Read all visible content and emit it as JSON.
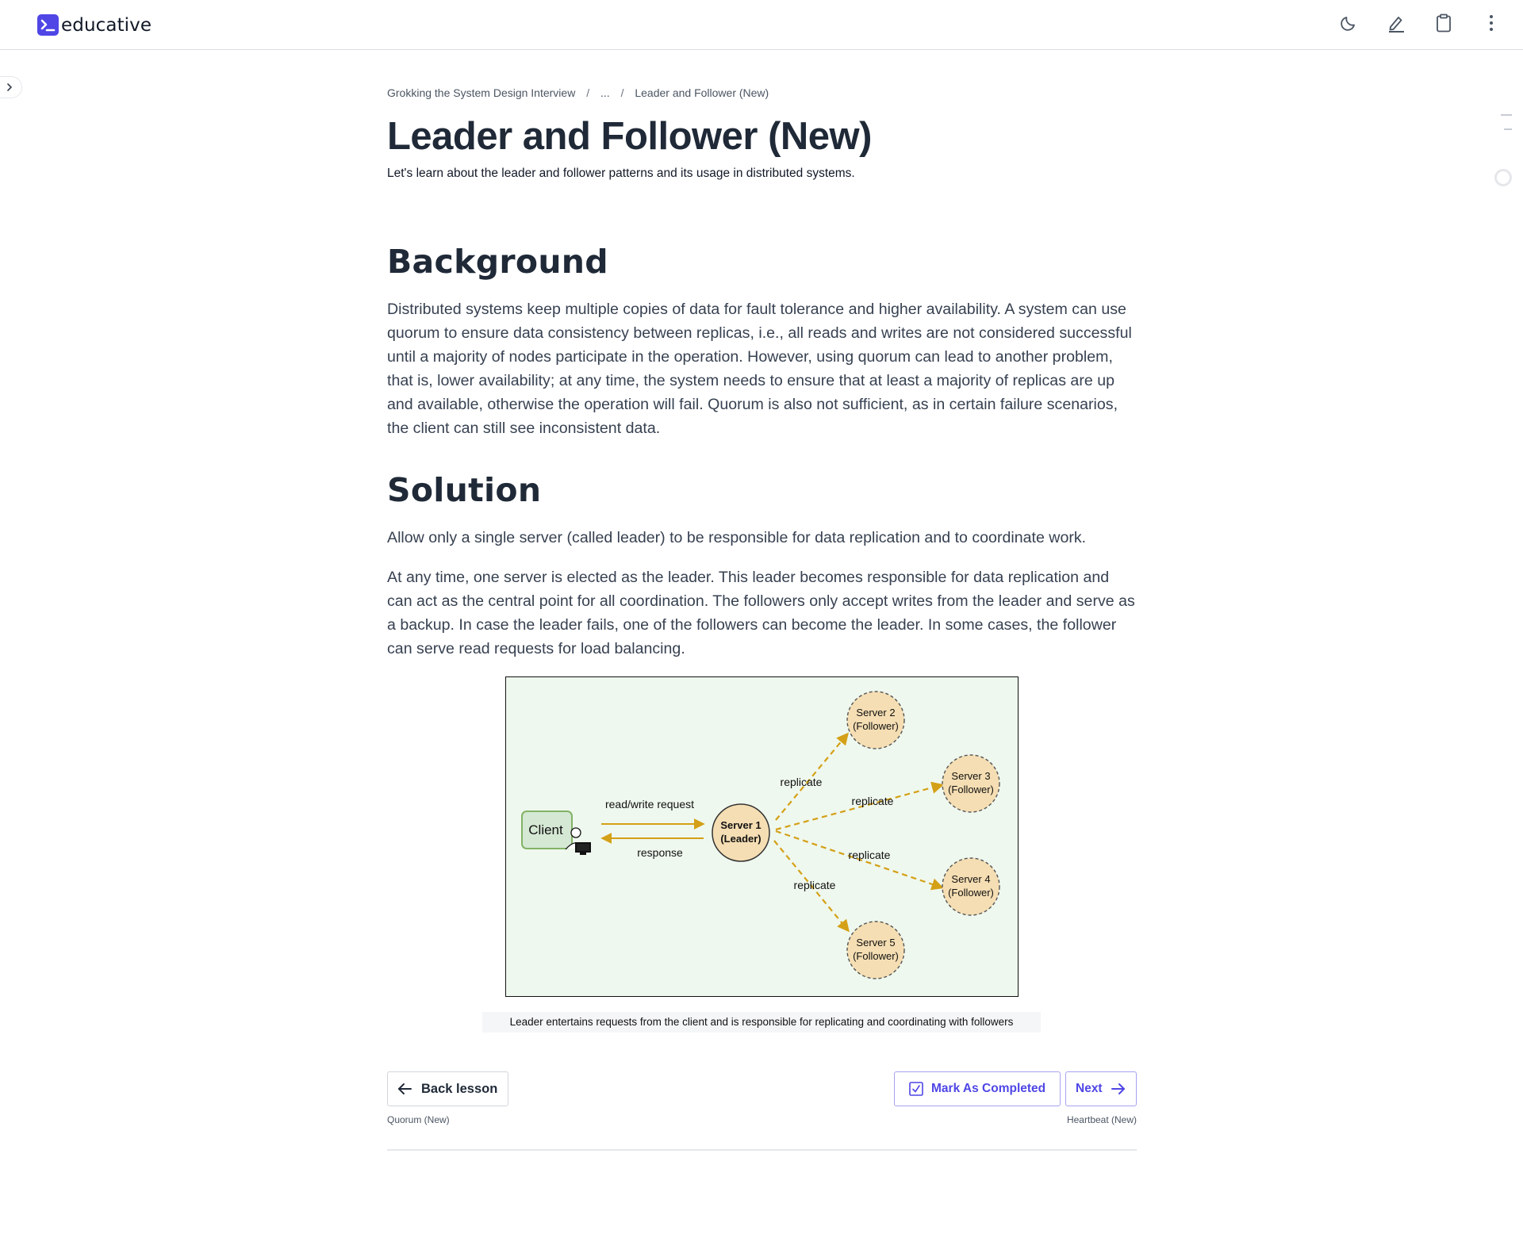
{
  "header": {
    "logo_text": "educative",
    "icons": [
      "moon-icon",
      "pen-icon",
      "clipboard-icon",
      "more-vertical-icon"
    ]
  },
  "breadcrumb": {
    "items": [
      "Grokking the System Design Interview",
      "...",
      "Leader and Follower (New)"
    ],
    "separator": "/"
  },
  "lesson": {
    "title": "Leader and Follower (New)",
    "subtitle": "Let's learn about the leader and follower patterns and its usage in distributed systems."
  },
  "sections": {
    "background": {
      "heading": "Background",
      "body": "Distributed systems keep multiple copies of data for fault tolerance and higher availability. A system can use quorum to ensure data consistency between replicas, i.e., all reads and writes are not considered successful until a majority of nodes participate in the operation. However, using quorum can lead to another problem, that is, lower availability; at any time, the system needs to ensure that at least a majority of replicas are up and available, otherwise the operation will fail. Quorum is also not sufficient, as in certain failure scenarios, the client can still see inconsistent data."
    },
    "solution": {
      "heading": "Solution",
      "para1": "Allow only a single server (called leader) to be responsible for data replication and to coordinate work.",
      "para2": "At any time, one server is elected as the leader. This leader becomes responsible for data replication and can act as the central point for all coordination. The followers only accept writes from the leader and serve as a backup. In case the leader fails, one of the followers can become the leader. In some cases, the follower can serve read requests for load balancing."
    }
  },
  "diagram": {
    "client_label": "Client",
    "request_label": "read/write request",
    "response_label": "response",
    "leader": [
      "Server 1",
      "(Leader)"
    ],
    "followers": [
      [
        "Server 2",
        "(Follower)"
      ],
      [
        "Server 3",
        "(Follower)"
      ],
      [
        "Server 4",
        "(Follower)"
      ],
      [
        "Server 5",
        "(Follower)"
      ]
    ],
    "replicate_label": "replicate",
    "caption": "Leader entertains requests from the client and is responsible for replicating and coordinating with followers",
    "colors": {
      "background": "#eff8ee",
      "node_fill": "#f5deb3",
      "arrow": "#d4a017",
      "client_fill": "#d5e8d4",
      "client_border": "#82b366"
    }
  },
  "navigation": {
    "back_label": "Back lesson",
    "back_sub": "Quorum (New)",
    "complete_label": "Mark As Completed",
    "next_label": "Next",
    "next_sub": "Heartbeat (New)"
  }
}
